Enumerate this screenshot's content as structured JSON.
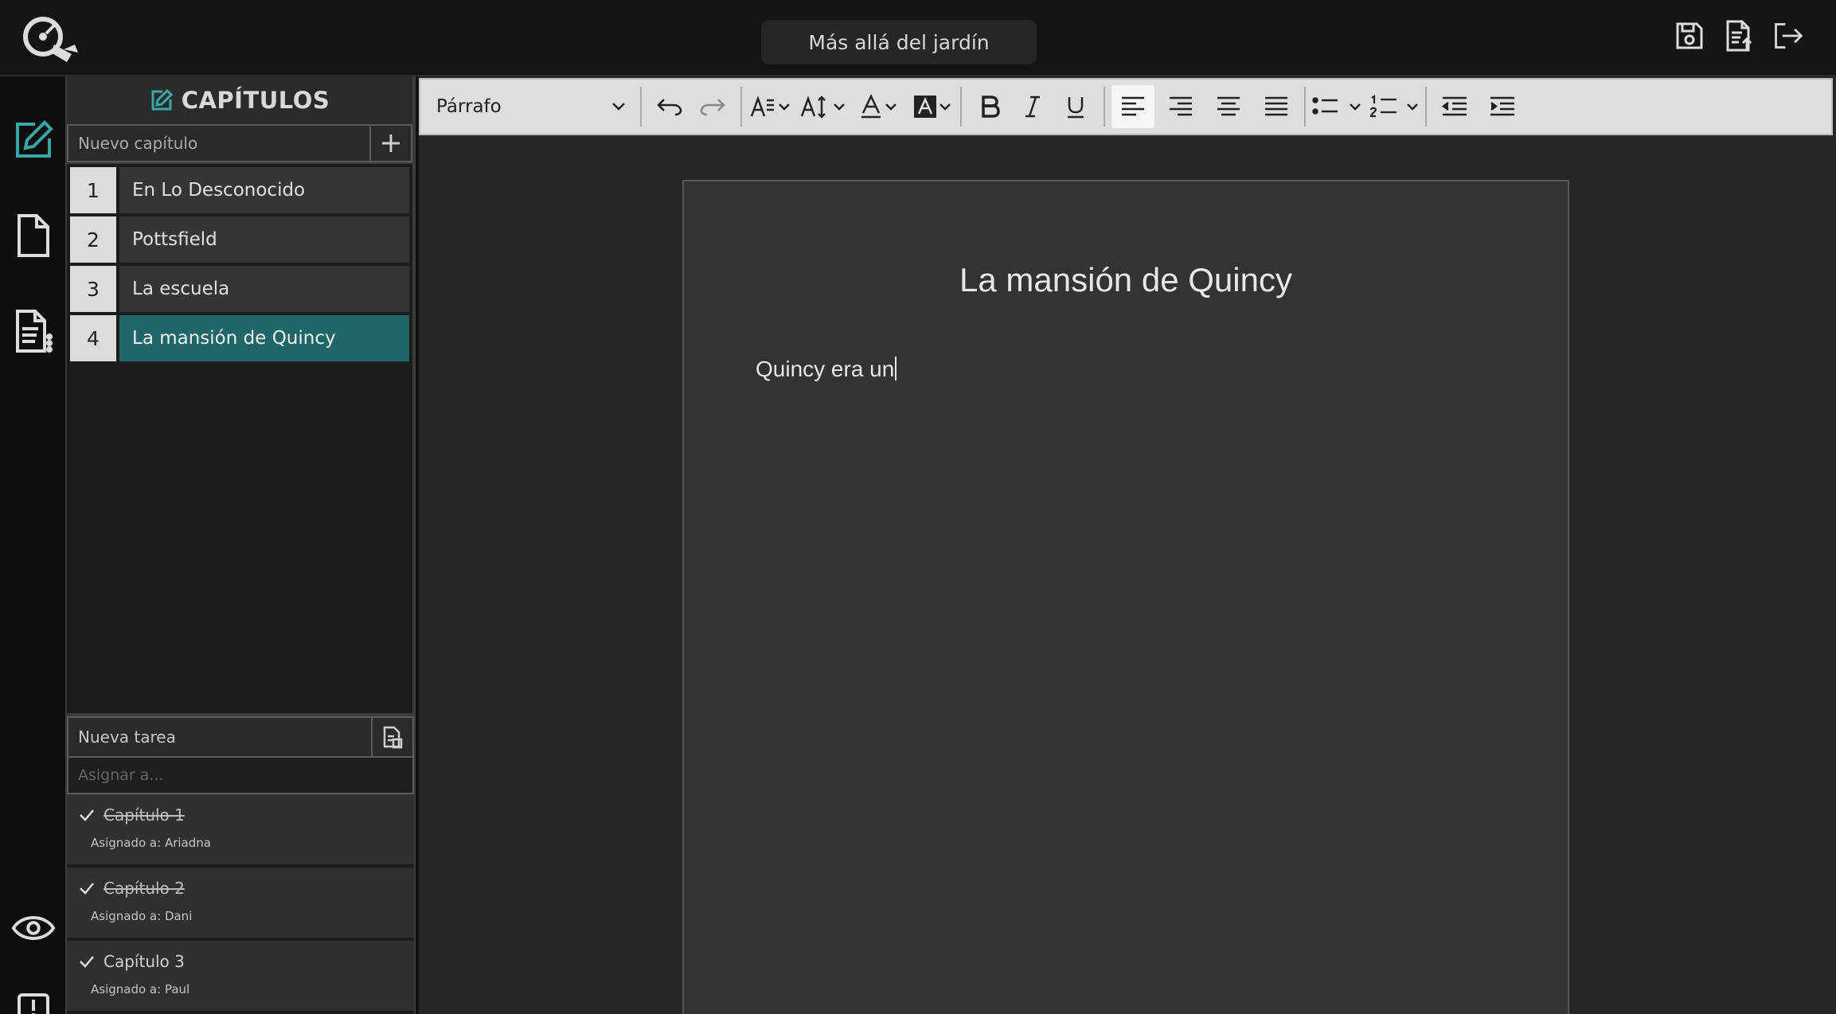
{
  "header": {
    "document_title": "Más allá del jardín"
  },
  "sidebar": {
    "header": "CAPÍTULOS",
    "new_chapter_placeholder": "Nuevo capítulo",
    "chapters": [
      {
        "number": "1",
        "name": "En Lo Desconocido"
      },
      {
        "number": "2",
        "name": "Pottsfield"
      },
      {
        "number": "3",
        "name": "La escuela"
      },
      {
        "number": "4",
        "name": "La mansión de Quincy"
      }
    ],
    "active_chapter": "4",
    "new_task_placeholder": "Nueva tarea",
    "assign_placeholder": "Asignar a...",
    "tasks": [
      {
        "title": "Capítulo 1",
        "assignee": "Asignado a: Ariadna",
        "done": true
      },
      {
        "title": "Capítulo 2",
        "assignee": "Asignado a: Dani",
        "done": true
      },
      {
        "title": "Capítulo 3",
        "assignee": "Asignado a: Paul",
        "done": false
      }
    ]
  },
  "toolbar": {
    "block_format": "Párrafo"
  },
  "editor": {
    "title": "La mansión de Quincy",
    "body": "Quincy era un"
  },
  "colors": {
    "accent": "#1f6668",
    "icon_active": "#3aa6a6"
  },
  "icons": {
    "logo": "pen-nib-magnifier-icon",
    "top_actions": [
      "save-icon",
      "export-document-icon",
      "logout-icon"
    ],
    "rail": [
      "edit-icon",
      "document-icon",
      "document-list-icon",
      "eye-icon",
      "alert-icon"
    ]
  }
}
